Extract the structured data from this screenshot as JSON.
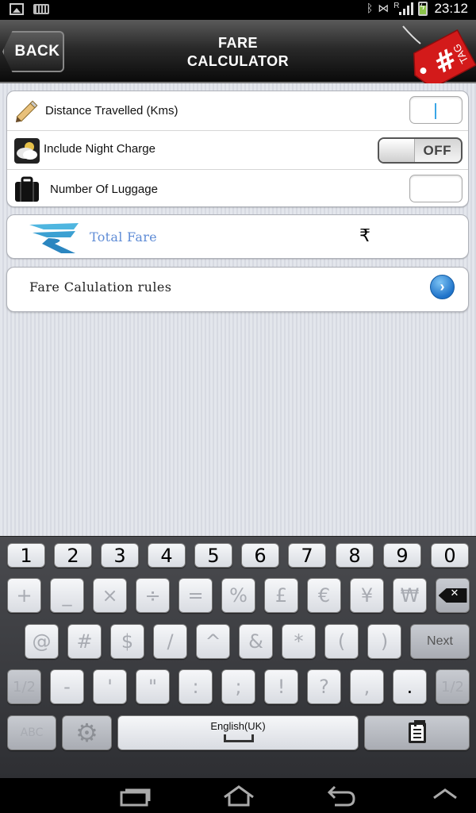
{
  "status_bar": {
    "time": "23:12",
    "signal_label": "R"
  },
  "header": {
    "back_label": "BACK",
    "title_line1": "FARE",
    "title_line2": "CALCULATOR",
    "logo_text": "TAG",
    "logo_symbol": "#"
  },
  "form": {
    "distance_label": "Distance Travelled (Kms)",
    "distance_value": "",
    "night_charge_label": "Include Night Charge",
    "night_charge_state": "OFF",
    "luggage_label": "Number Of Luggage",
    "luggage_value": ""
  },
  "fare": {
    "label": "Total Fare",
    "currency": "₹"
  },
  "rules": {
    "label": "Fare Calulation rules"
  },
  "keyboard": {
    "row1": [
      "1",
      "2",
      "3",
      "4",
      "5",
      "6",
      "7",
      "8",
      "9",
      "0"
    ],
    "row2": [
      "+",
      "_",
      "×",
      "÷",
      "=",
      "%",
      "£",
      "€",
      "¥",
      "₩"
    ],
    "row3": [
      "@",
      "#",
      "$",
      "/",
      "^",
      "&",
      "*",
      "(",
      ")"
    ],
    "next_label": "Next",
    "row4": [
      "1/2",
      "-",
      "'",
      "\"",
      ":",
      ";",
      "!",
      "?",
      ",",
      ".",
      "1/2"
    ],
    "abc_label": "ABC",
    "language_label": "English(UK)"
  },
  "colors": {
    "accent_blue": "#1f73c9",
    "fare_label": "#5f8cd6",
    "cursor": "#3aa6e6",
    "tag_red": "#d31a1a"
  }
}
